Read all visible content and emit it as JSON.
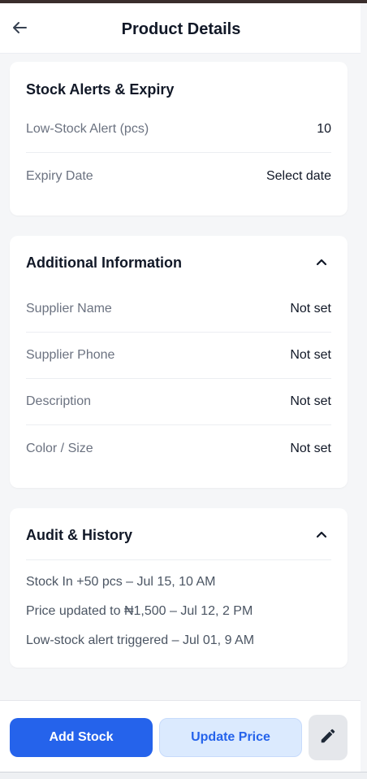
{
  "header": {
    "title": "Product Details",
    "back_icon": "arrow-left-icon"
  },
  "stock_alerts": {
    "title": "Stock Alerts & Expiry",
    "rows": [
      {
        "label": "Low-Stock Alert (pcs)",
        "value": "10"
      },
      {
        "label": "Expiry Date",
        "value": "Select date"
      }
    ]
  },
  "additional_info": {
    "title": "Additional Information",
    "expanded": true,
    "rows": [
      {
        "label": "Supplier Name",
        "value": "Not set"
      },
      {
        "label": "Supplier Phone",
        "value": "Not set"
      },
      {
        "label": "Description",
        "value": "Not set"
      },
      {
        "label": "Color / Size",
        "value": "Not set"
      }
    ]
  },
  "audit": {
    "title": "Audit & History",
    "expanded": true,
    "entries": [
      "Stock In +50 pcs – Jul 15, 10 AM",
      "Price updated to ₦1,500 – Jul 12, 2 PM",
      "Low-stock alert triggered – Jul 01, 9 AM"
    ]
  },
  "actions": {
    "add_stock": "Add Stock",
    "update_price": "Update Price",
    "edit_icon": "pencil-icon"
  },
  "colors": {
    "primary": "#2563eb",
    "primary_light": "#dbeafe",
    "background": "#f5f6f8"
  }
}
